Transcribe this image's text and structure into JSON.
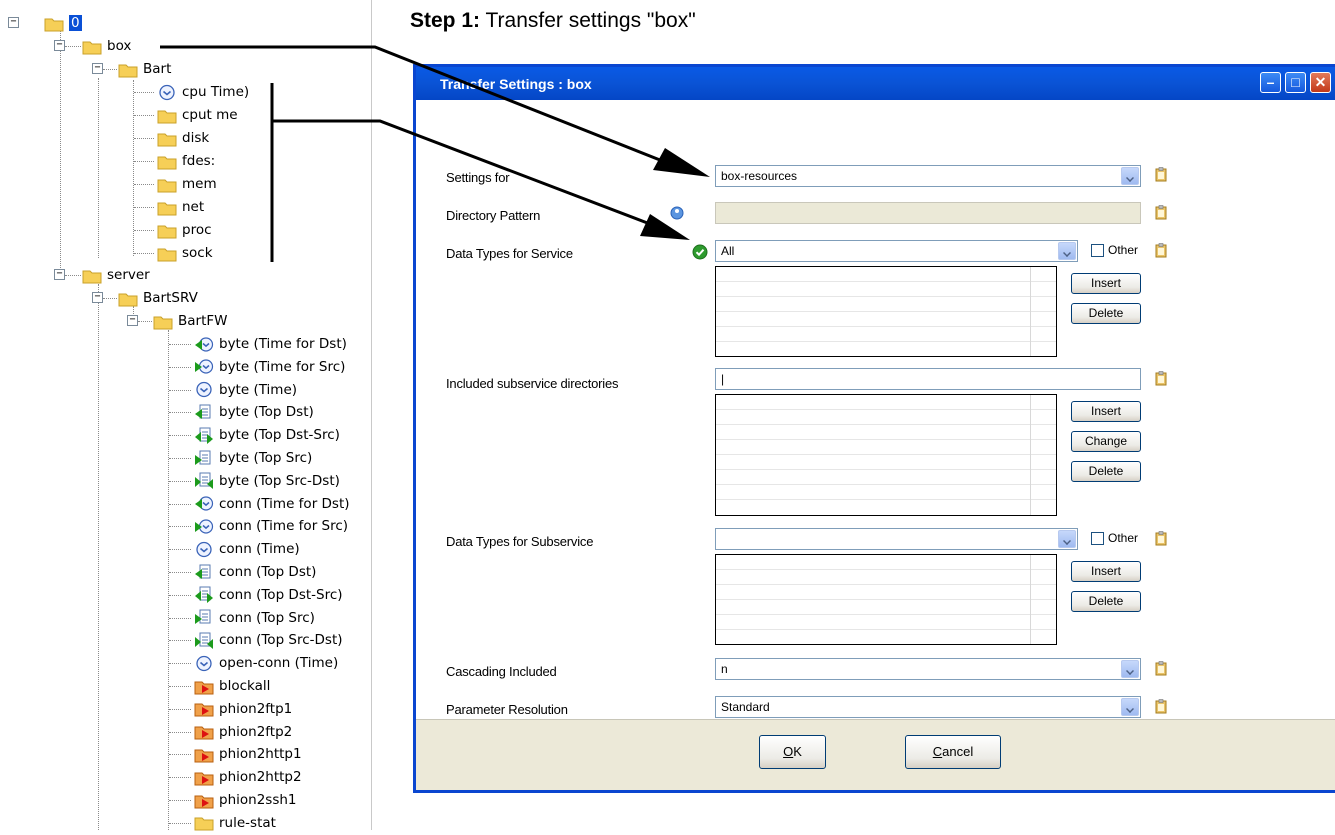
{
  "heading": {
    "bold": "Step 1:",
    "rest": " Transfer settings \"box\""
  },
  "tree": {
    "root": "0",
    "box": "box",
    "bart": "Bart",
    "bart_children": [
      "cpu Time)",
      "cput me",
      "disk",
      "fdes:",
      "mem",
      "net",
      "proc",
      "sock"
    ],
    "server": "server",
    "bartsrv": "BartSRV",
    "bartfw": "BartFW",
    "bartfw_children": [
      "byte (Time for Dst)",
      "byte (Time for Src)",
      "byte (Time)",
      "byte (Top Dst)",
      "byte (Top Dst-Src)",
      "byte (Top Src)",
      "byte (Top Src-Dst)",
      "conn (Time for Dst)",
      "conn (Time for Src)",
      "conn (Time)",
      "conn (Top Dst)",
      "conn (Top Dst-Src)",
      "conn (Top Src)",
      "conn (Top Src-Dst)",
      "open-conn (Time)",
      "blockall",
      "phion2ftp1",
      "phion2ftp2",
      "phion2http1",
      "phion2http2",
      "phion2ssh1",
      "rule-stat"
    ]
  },
  "dialog": {
    "title": "Transfer Settings : box",
    "settings_for_label": "Settings for",
    "settings_for_value": "box-resources",
    "directory_pattern_label": "Directory Pattern",
    "data_types_service_label": "Data Types for Service",
    "data_types_service_value": "All",
    "other_label": "Other",
    "insert": "Insert",
    "delete": "Delete",
    "change": "Change",
    "included_subservice_label": "Included subservice directories",
    "included_subservice_value": "|",
    "data_types_subservice_label": "Data Types for Subservice",
    "data_types_subservice_value": "",
    "cascading_label": "Cascading Included",
    "cascading_value": "n",
    "param_resolution_label": "Parameter Resolution",
    "param_resolution_value": "Standard",
    "ok_mnemonic": "O",
    "ok_rest": "K",
    "cancel_mnemonic": "C",
    "cancel_rest": "ancel"
  },
  "colors": {
    "titlebar": "#0a53d5",
    "selection": "#0a50d6",
    "footer": "#ece9d8",
    "check_green": "#2e9b2e"
  }
}
